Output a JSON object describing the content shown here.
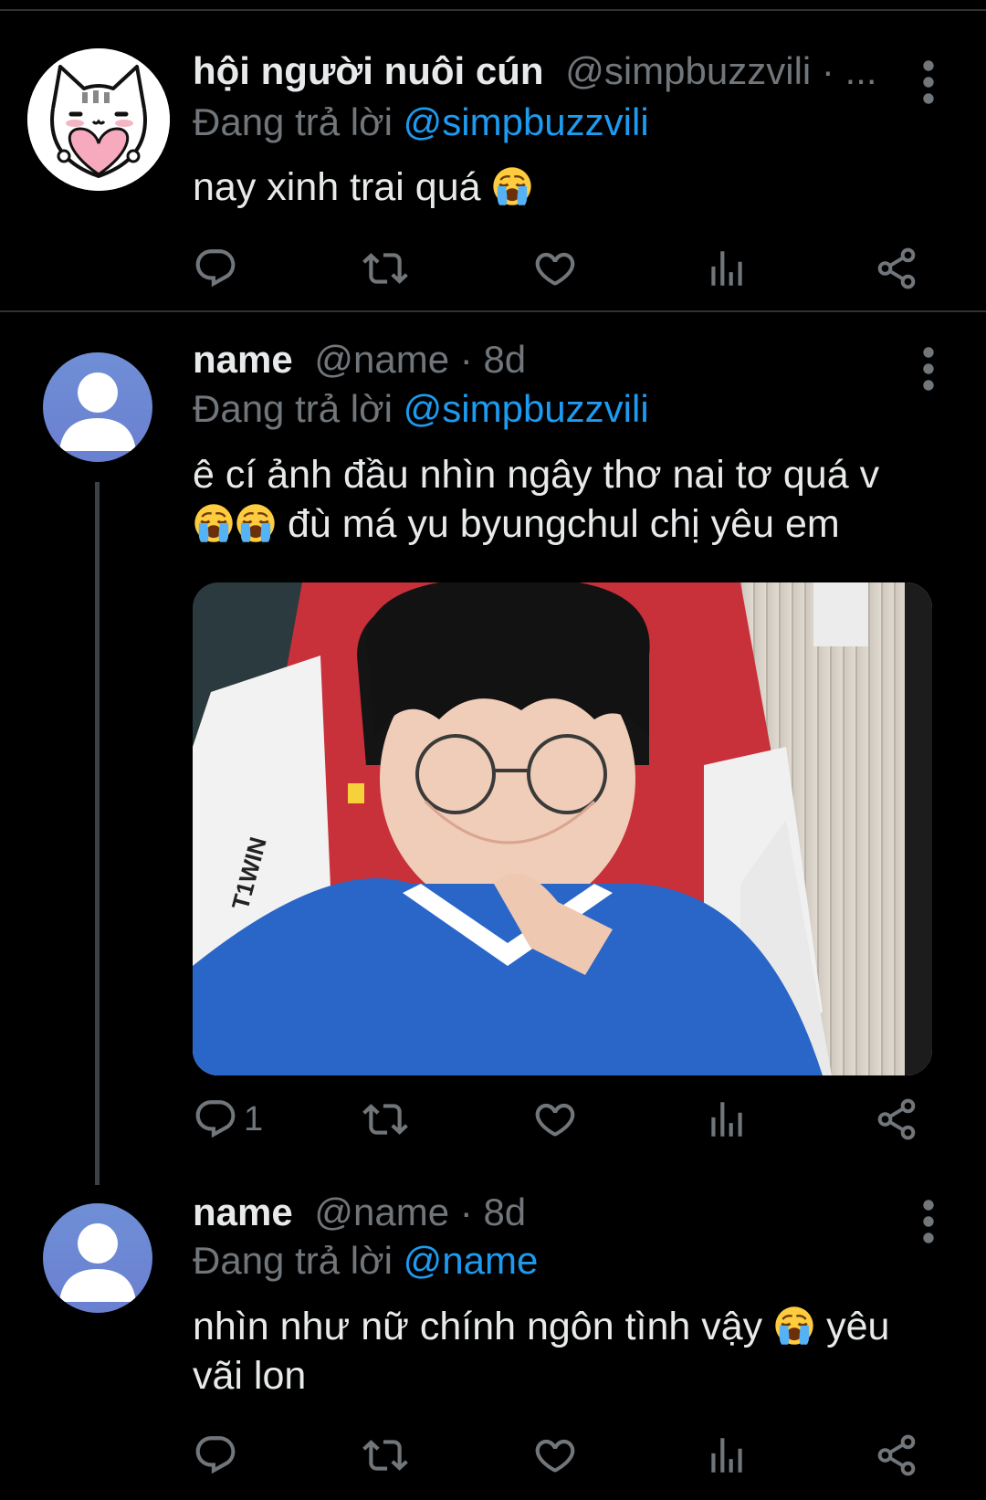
{
  "tweets": [
    {
      "display_name": "hội người nuôi cún",
      "handle": "@simpbuzzvili",
      "dot": "·",
      "time": "...",
      "replying_prefix": "Đang trả lời",
      "replying_to": "@simpbuzzvili",
      "text": "nay xinh trai quá",
      "reply_count": ""
    },
    {
      "display_name": "name",
      "handle": "@name",
      "dot": "·",
      "time": "8d",
      "replying_prefix": "Đang trả lời",
      "replying_to": "@simpbuzzvili",
      "text_line1": "ê cí ảnh đầu nhìn ngây thơ nai tơ quá v",
      "text_line2": "đù má yu byungchul chị yêu em",
      "media_jersey_text": "T1WIN",
      "reply_count": "1"
    },
    {
      "display_name": "name",
      "handle": "@name",
      "dot": "·",
      "time": "8d",
      "replying_prefix": "Đang trả lời",
      "replying_to": "@name",
      "text_line1": "nhìn như nữ chính ngôn tình vậy",
      "text_line1_end": "yêu",
      "text_line2": "vãi lon",
      "reply_count": ""
    }
  ],
  "icons": {
    "reply": "reply-icon",
    "retweet": "retweet-icon",
    "like": "heart-icon",
    "views": "analytics-icon",
    "share": "share-icon",
    "more": "more-vertical-icon",
    "emoji": "loudly-crying-face-emoji"
  },
  "colors": {
    "background": "#000000",
    "text": "#e7e9ea",
    "secondary": "#71767b",
    "accent": "#1d9bf0",
    "divider": "#2f3336"
  }
}
